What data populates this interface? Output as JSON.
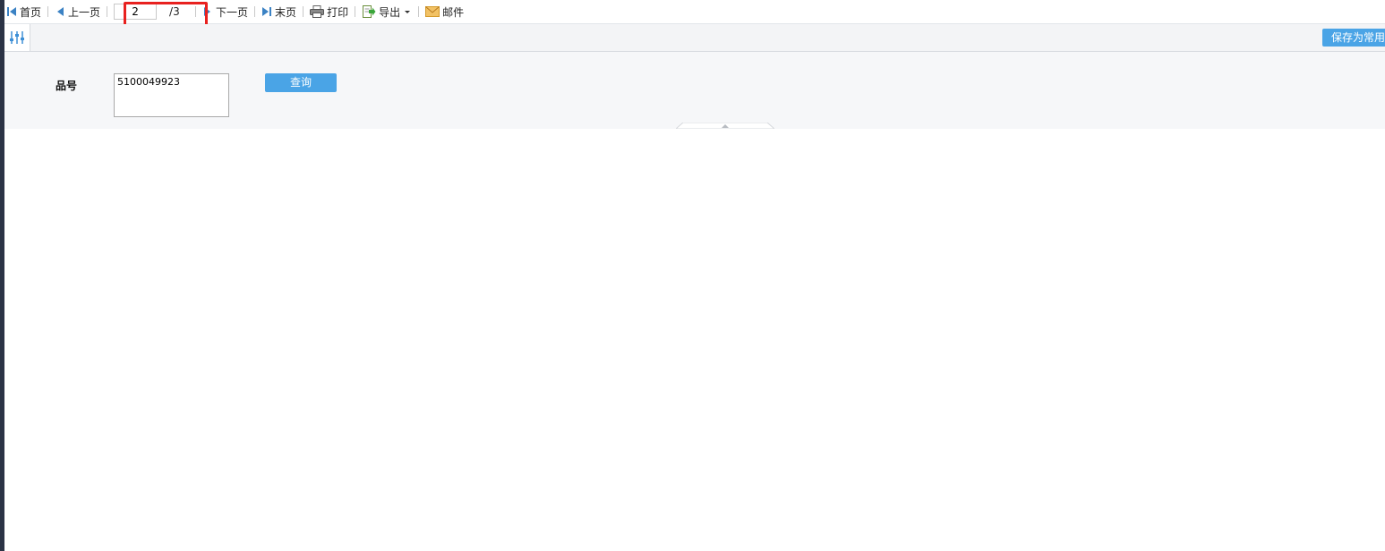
{
  "toolbar": {
    "first_label": "首页",
    "prev_label": "上一页",
    "current_page": "2",
    "total_pages": "/3",
    "next_label": "下一页",
    "last_label": "末页",
    "print_label": "打印",
    "export_label": "导出",
    "mail_label": "邮件"
  },
  "settings": {
    "save_label": "保存为常用"
  },
  "form": {
    "field_label": "品号",
    "field_value": "5100049923",
    "query_label": "查询"
  },
  "colors": {
    "accent": "#4aa4e6",
    "highlight": "#e8211f"
  }
}
